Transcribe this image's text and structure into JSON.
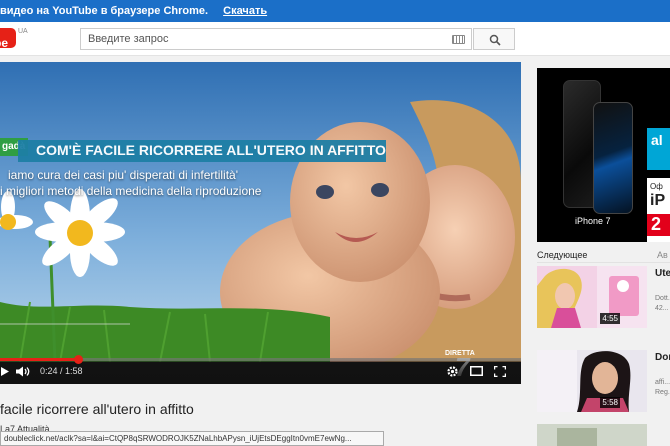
{
  "banner": {
    "text": "видео на YouTube в браузере Chrome.",
    "link": "Скачать"
  },
  "header": {
    "logo_text": "be",
    "logo_region": "UA",
    "search_placeholder": "Введите запрос"
  },
  "player": {
    "brand_tag": "gadà",
    "headline": "COM'È FACILE RICORRERE ALL'UTERO IN AFFITTO",
    "subtitle_1": "iamo cura dei casi piu' disperati di infertilità'",
    "subtitle_2": "i migliori metodi della medicina della riproduzione",
    "channel_logo_top": "DIRETTA",
    "channel_logo_num": "7",
    "current_time": "0:24",
    "duration": "1:58",
    "time_display": "0:24 / 1:58",
    "progress": 0.15
  },
  "video": {
    "title": "facile ricorrere all'utero in affitto",
    "channel": "La7 Attualità"
  },
  "statusbar": {
    "url": "doubleclick.net/aclk?sa=l&ai=CtQP8qSRWODROJK5ZNaLhbAPysn_iUjEtsDEggItn0vmE7ewNg..."
  },
  "sidebar": {
    "ad": {
      "brand": "iPhone 7",
      "cyan_text": "al",
      "promo_small": "Оф",
      "promo_model": "iP",
      "promo_price": "2"
    },
    "next_label": "Следующее",
    "autoplay_label": "Ав",
    "items": [
      {
        "title": "Ute...",
        "meta": "Dott... 42...",
        "duration": "4:55"
      },
      {
        "title": "Don...",
        "meta": "affi... Reg...",
        "duration": "5:58"
      }
    ]
  },
  "colors": {
    "youtube_red": "#e62117",
    "banner_blue": "#1b6fc8",
    "headline_band": "#1e7fa6"
  }
}
